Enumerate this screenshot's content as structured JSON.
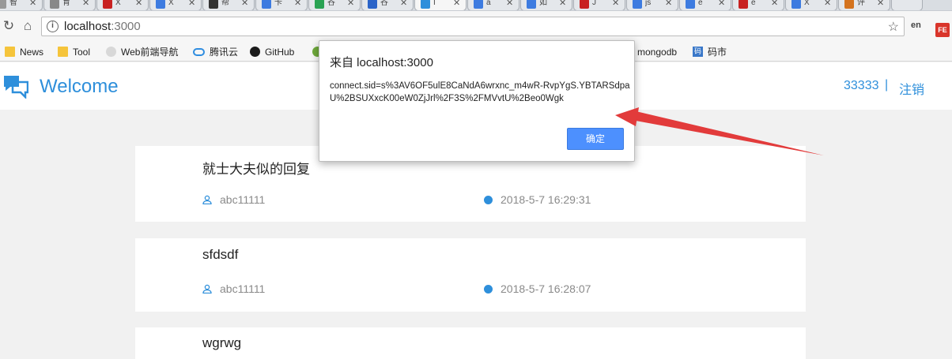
{
  "tabs": [
    {
      "title": "智",
      "fav": "#999",
      "active": false
    },
    {
      "title": "育",
      "fav": "#888",
      "active": false
    },
    {
      "title": "X",
      "fav": "#c82121",
      "active": false
    },
    {
      "title": "X",
      "fav": "#3d7be0",
      "active": false
    },
    {
      "title": "帮",
      "fav": "#333",
      "active": false
    },
    {
      "title": "卡",
      "fav": "#3d7be0",
      "active": false
    },
    {
      "title": "谷",
      "fav": "#2aa354",
      "active": false
    },
    {
      "title": "谷",
      "fav": "#2a63c8",
      "active": false
    },
    {
      "title": "I",
      "fav": "#2e8fdb",
      "active": true
    },
    {
      "title": "a",
      "fav": "#3d7be0",
      "active": false
    },
    {
      "title": "如",
      "fav": "#3d7be0",
      "active": false
    },
    {
      "title": "J",
      "fav": "#c82121",
      "active": false
    },
    {
      "title": "js",
      "fav": "#3d7be0",
      "active": false
    },
    {
      "title": "e",
      "fav": "#3d7be0",
      "active": false
    },
    {
      "title": "e",
      "fav": "#c82121",
      "active": false
    },
    {
      "title": "X",
      "fav": "#3d7be0",
      "active": false
    },
    {
      "title": "评",
      "fav": "#d4731e",
      "active": false
    }
  ],
  "address": {
    "host": "localhost",
    "port": ":3000"
  },
  "extensions": {
    "ext1": "en",
    "ext2": "FE"
  },
  "bookmarks": [
    {
      "label": "News",
      "icon": "folder-icon"
    },
    {
      "label": "Tool",
      "icon": "folder-icon"
    },
    {
      "label": "Web前端导航",
      "icon": "web-nav-icon"
    },
    {
      "label": "腾讯云",
      "icon": "cloud-icon"
    },
    {
      "label": "GitHub",
      "icon": "github-icon"
    },
    {
      "label": "mongodb",
      "icon": "mongodb-icon"
    },
    {
      "label": "码市",
      "icon": "mashi-icon"
    }
  ],
  "header": {
    "title": "Welcome",
    "user": "33333",
    "separator": "|",
    "logout": "注销"
  },
  "posts": [
    {
      "title": "就士大夫似的回复",
      "author": "abc11111",
      "time": "2018-5-7 16:29:31"
    },
    {
      "title": "sfdsdf",
      "author": "abc11111",
      "time": "2018-5-7 16:28:07"
    },
    {
      "title": "wgrwg",
      "author": "",
      "time": ""
    }
  ],
  "dialog": {
    "title": "来自 localhost:3000",
    "message": "connect.sid=s%3AV6OF5ulE8CaNdA6wrxnc_m4wR-RvpYgS.YBTARSdpaU%2BSUXxcK00eW0ZjJrl%2F3S%2FMVvtU%2Beo0Wgk",
    "ok_label": "确定"
  },
  "colors": {
    "accent": "#2e8fdb",
    "dialog_button": "#4d90fe",
    "arrow": "#e23b3b"
  }
}
